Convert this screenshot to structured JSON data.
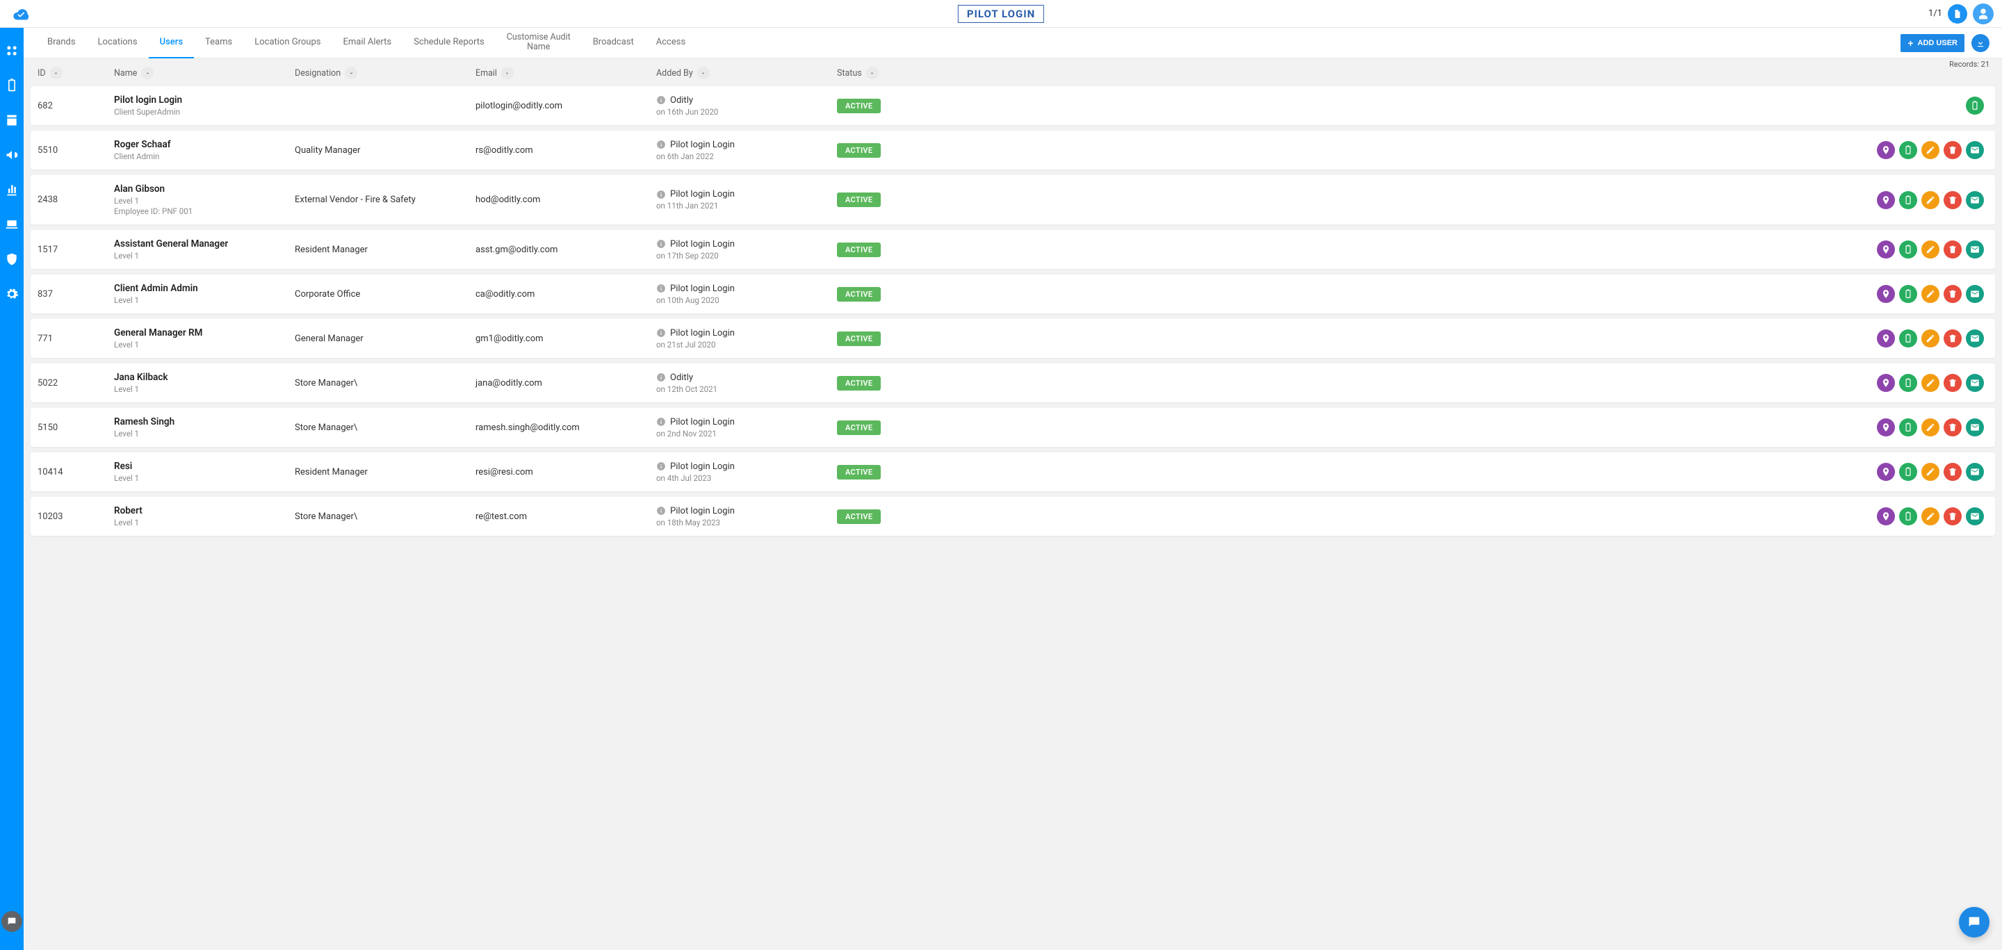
{
  "topbar": {
    "title": "PILOT LOGIN",
    "page_indicator": "1/1"
  },
  "tabs": [
    {
      "label": "Brands"
    },
    {
      "label": "Locations"
    },
    {
      "label": "Users",
      "active": true
    },
    {
      "label": "Teams"
    },
    {
      "label": "Location Groups"
    },
    {
      "label": "Email Alerts"
    },
    {
      "label": "Schedule Reports"
    },
    {
      "label": "Customise Audit Name",
      "two_line": true
    },
    {
      "label": "Broadcast"
    },
    {
      "label": "Access"
    }
  ],
  "add_user_label": "ADD USER",
  "records_label": "Records: 21",
  "columns": {
    "id": "ID",
    "name": "Name",
    "designation": "Designation",
    "email": "Email",
    "added_by": "Added By",
    "status": "Status"
  },
  "rows": [
    {
      "id": "682",
      "name": "Pilot login Login",
      "role": "Client SuperAdmin",
      "emp": "",
      "designation": "",
      "email": "pilotlogin@oditly.com",
      "added_by": "Oditly",
      "added_on": "on 16th Jun 2020",
      "status": "ACTIVE",
      "actions": [
        "clip"
      ]
    },
    {
      "id": "5510",
      "name": "Roger Schaaf",
      "role": "Client Admin",
      "emp": "",
      "designation": "Quality Manager",
      "email": "rs@oditly.com",
      "added_by": "Pilot login Login",
      "added_on": "on 6th Jan 2022",
      "status": "ACTIVE",
      "actions": [
        "loc",
        "clip",
        "edit",
        "del",
        "mail"
      ]
    },
    {
      "id": "2438",
      "name": "Alan Gibson",
      "role": "Level 1",
      "emp": "Employee ID: PNF 001",
      "designation": "External Vendor - Fire & Safety",
      "email": "hod@oditly.com",
      "added_by": "Pilot login Login",
      "added_on": "on 11th Jan 2021",
      "status": "ACTIVE",
      "actions": [
        "loc",
        "clip",
        "edit",
        "del",
        "mail"
      ]
    },
    {
      "id": "1517",
      "name": "Assistant General Manager",
      "role": "Level 1",
      "emp": "",
      "designation": "Resident Manager",
      "email": "asst.gm@oditly.com",
      "added_by": "Pilot login Login",
      "added_on": "on 17th Sep 2020",
      "status": "ACTIVE",
      "actions": [
        "loc",
        "clip",
        "edit",
        "del",
        "mail"
      ]
    },
    {
      "id": "837",
      "name": "Client Admin Admin",
      "role": "Level 1",
      "emp": "",
      "designation": "Corporate Office",
      "email": "ca@oditly.com",
      "added_by": "Pilot login Login",
      "added_on": "on 10th Aug 2020",
      "status": "ACTIVE",
      "actions": [
        "loc",
        "clip",
        "edit",
        "del",
        "mail"
      ]
    },
    {
      "id": "771",
      "name": "General Manager RM",
      "role": "Level 1",
      "emp": "",
      "designation": "General Manager",
      "email": "gm1@oditly.com",
      "added_by": "Pilot login Login",
      "added_on": "on 21st Jul 2020",
      "status": "ACTIVE",
      "actions": [
        "loc",
        "clip",
        "edit",
        "del",
        "mail"
      ]
    },
    {
      "id": "5022",
      "name": "Jana Kilback",
      "role": "Level 1",
      "emp": "",
      "designation": "Store Manager\\",
      "email": "jana@oditly.com",
      "added_by": "Oditly",
      "added_on": "on 12th Oct 2021",
      "status": "ACTIVE",
      "actions": [
        "loc",
        "clip",
        "edit",
        "del",
        "mail"
      ]
    },
    {
      "id": "5150",
      "name": "Ramesh Singh",
      "role": "Level 1",
      "emp": "",
      "designation": "Store Manager\\",
      "email": "ramesh.singh@oditly.com",
      "added_by": "Pilot login Login",
      "added_on": "on 2nd Nov 2021",
      "status": "ACTIVE",
      "actions": [
        "loc",
        "clip",
        "edit",
        "del",
        "mail"
      ]
    },
    {
      "id": "10414",
      "name": "Resi",
      "role": "Level 1",
      "emp": "",
      "designation": "Resident Manager",
      "email": "resi@resi.com",
      "added_by": "Pilot login Login",
      "added_on": "on 4th Jul 2023",
      "status": "ACTIVE",
      "actions": [
        "loc",
        "clip",
        "edit",
        "del",
        "mail"
      ]
    },
    {
      "id": "10203",
      "name": "Robert",
      "role": "Level 1",
      "emp": "",
      "designation": "Store Manager\\",
      "email": "re@test.com",
      "added_by": "Pilot login Login",
      "added_on": "on 18th May 2023",
      "status": "ACTIVE",
      "actions": [
        "loc",
        "clip",
        "edit",
        "del",
        "mail"
      ]
    }
  ]
}
